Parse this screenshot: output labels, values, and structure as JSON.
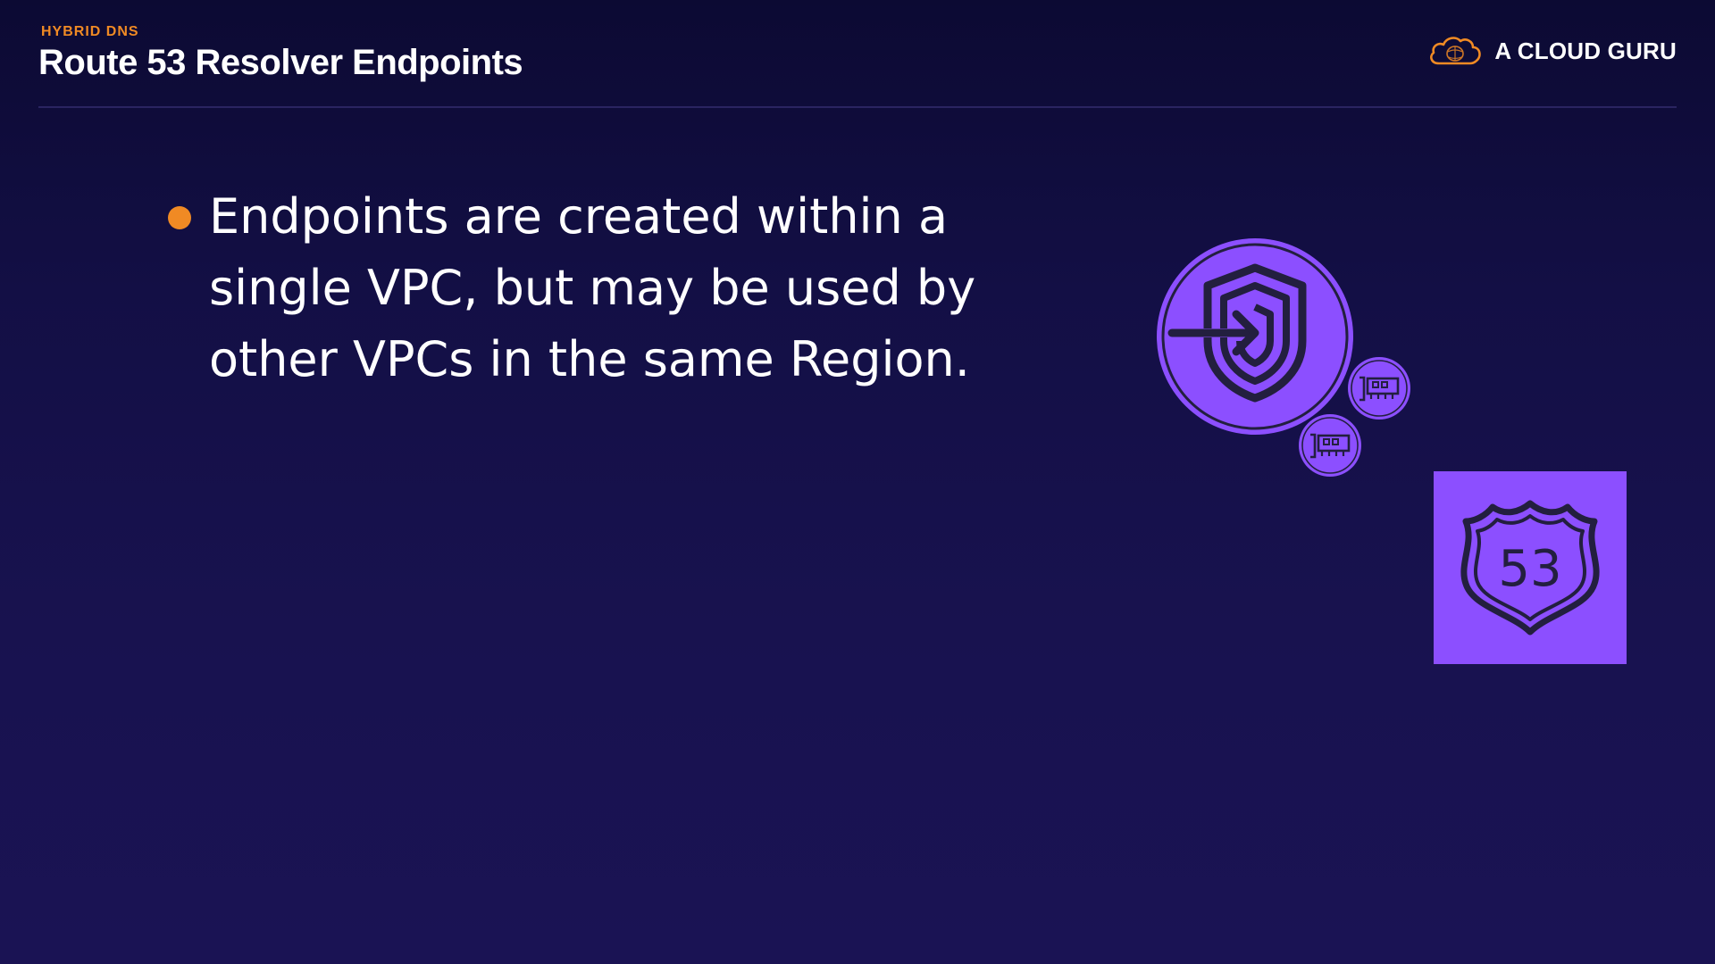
{
  "header": {
    "eyebrow": "HYBRID DNS",
    "title": "Route 53 Resolver Endpoints"
  },
  "brand": {
    "name": "A CLOUD GURU",
    "logo_icon": "cloud-logo-icon"
  },
  "bullets": [
    {
      "text": "Endpoints are created within a single VPC, but may be used by other VPCs in the same Region."
    }
  ],
  "icons": {
    "endpoint": "resolver-endpoint-icon",
    "network_interface": "network-interface-icon",
    "route53": "route53-icon",
    "route53_number": "53"
  },
  "colors": {
    "accent": "#f08a24",
    "icon_purple": "#8c4fff",
    "background_top": "#0c0a33",
    "background_bottom": "#1a1354",
    "icon_stroke": "#231f3f"
  }
}
